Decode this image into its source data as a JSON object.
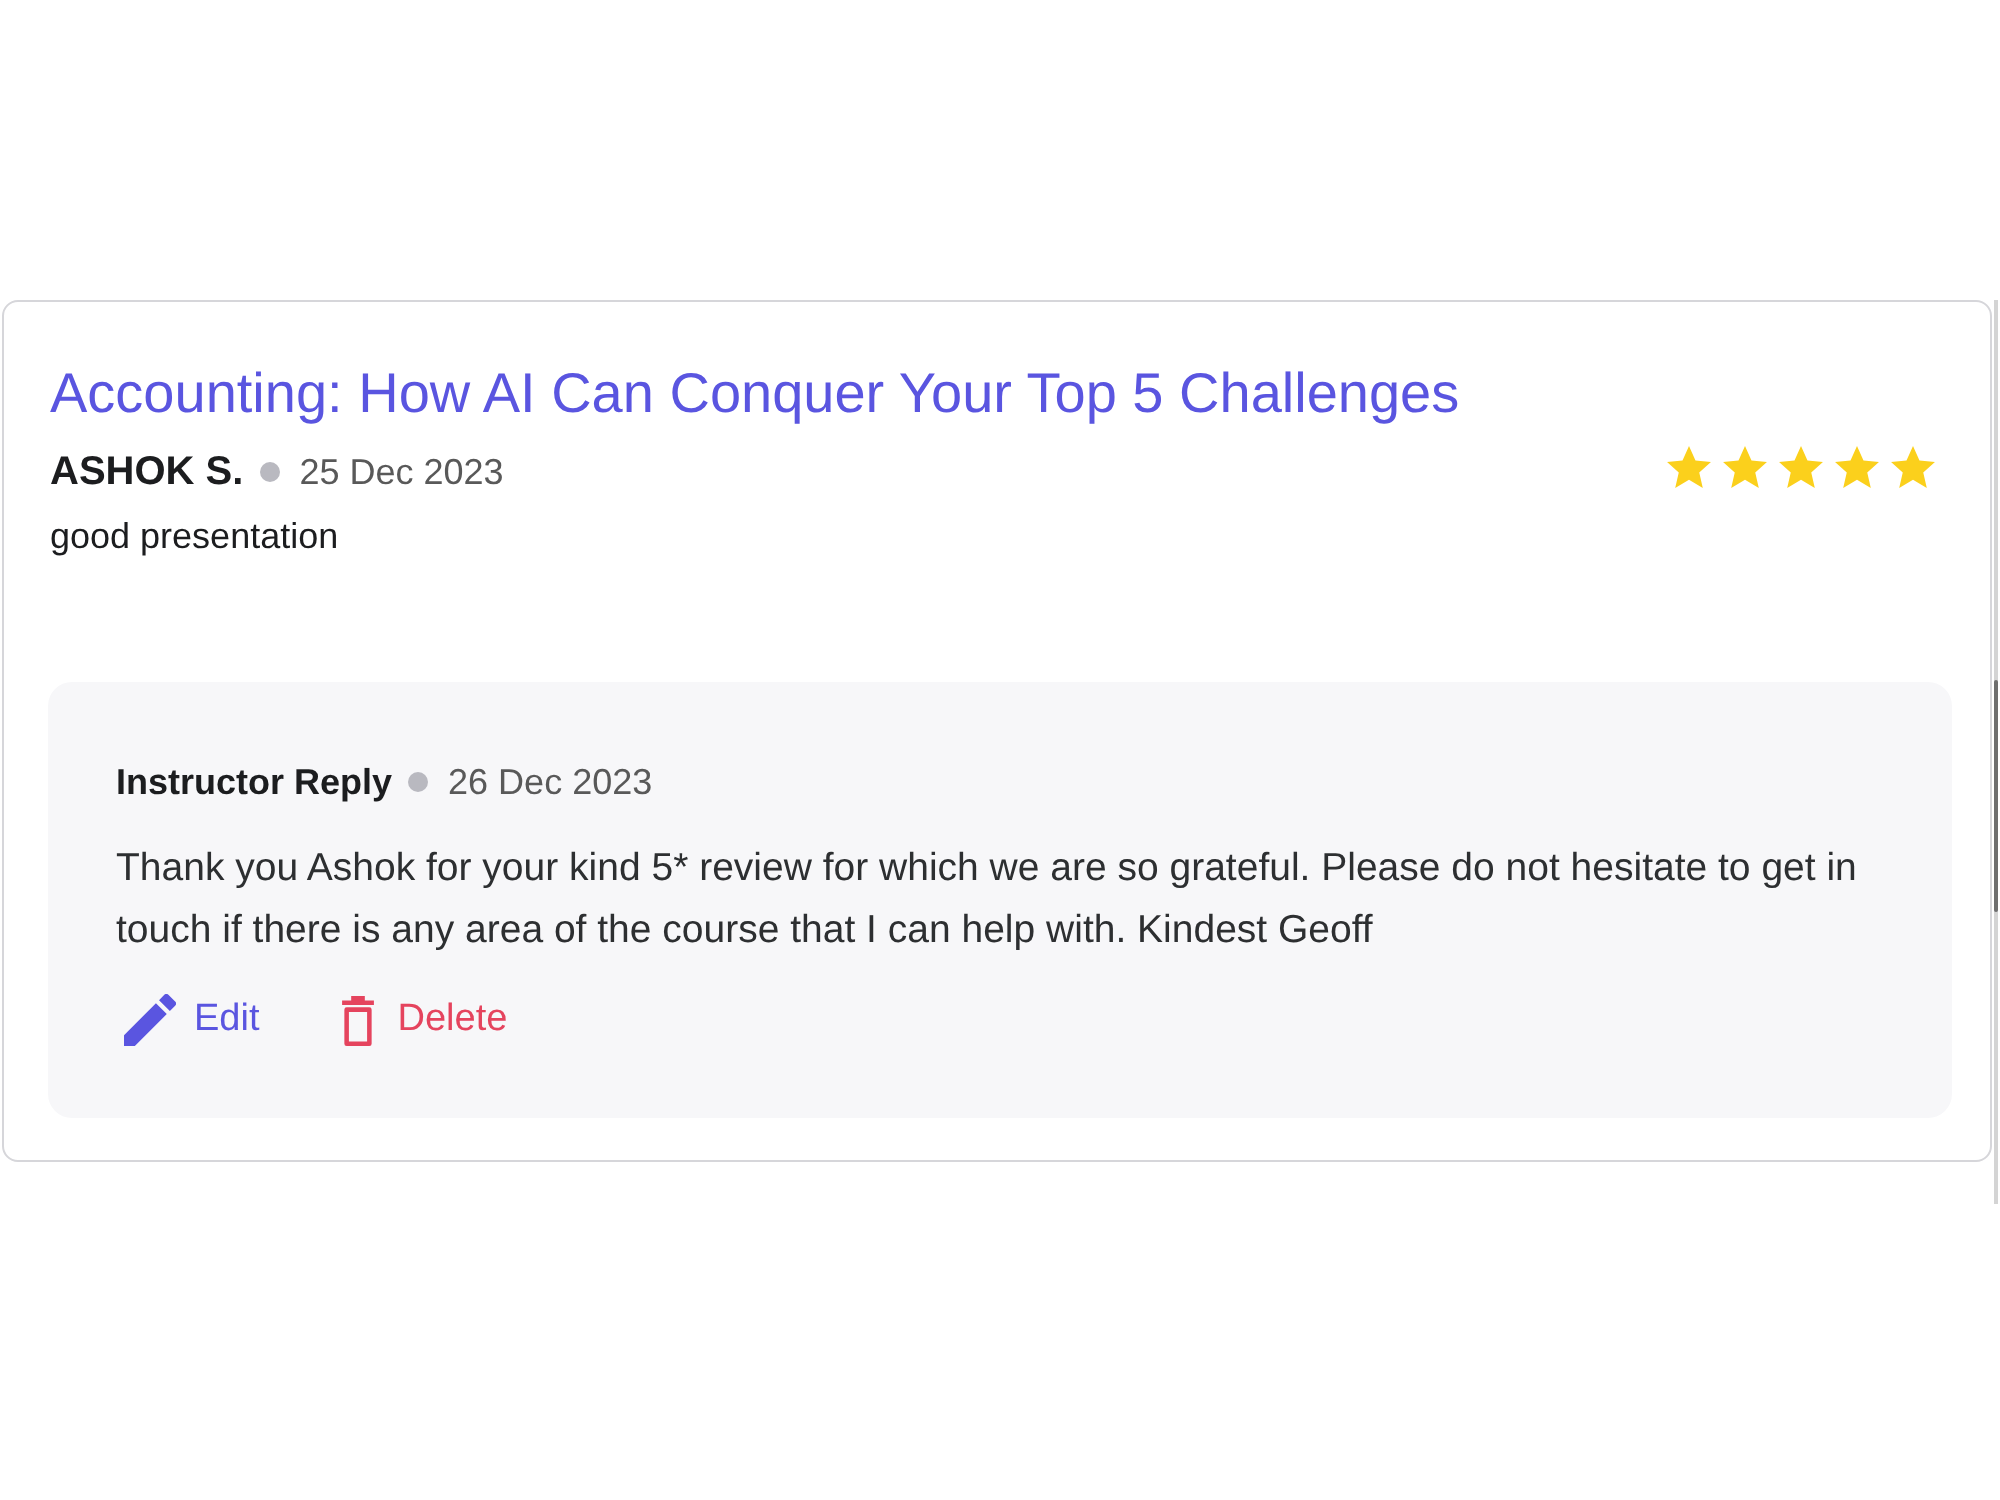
{
  "review": {
    "course_title": "Accounting: How AI Can Conquer Your Top 5 Challenges",
    "author": "ASHOK S.",
    "date": "25 Dec 2023",
    "stars": 5,
    "comment": "good presentation"
  },
  "reply": {
    "heading": "Instructor Reply",
    "date": "26 Dec 2023",
    "text": "Thank you Ashok for your kind 5* review for which we are so grateful. Please do not hesitate to get in touch if there is any area of the course that I can help with. Kindest Geoff",
    "actions": [
      {
        "kind": "edit",
        "label": "Edit"
      },
      {
        "kind": "delete",
        "label": "Delete"
      }
    ]
  }
}
